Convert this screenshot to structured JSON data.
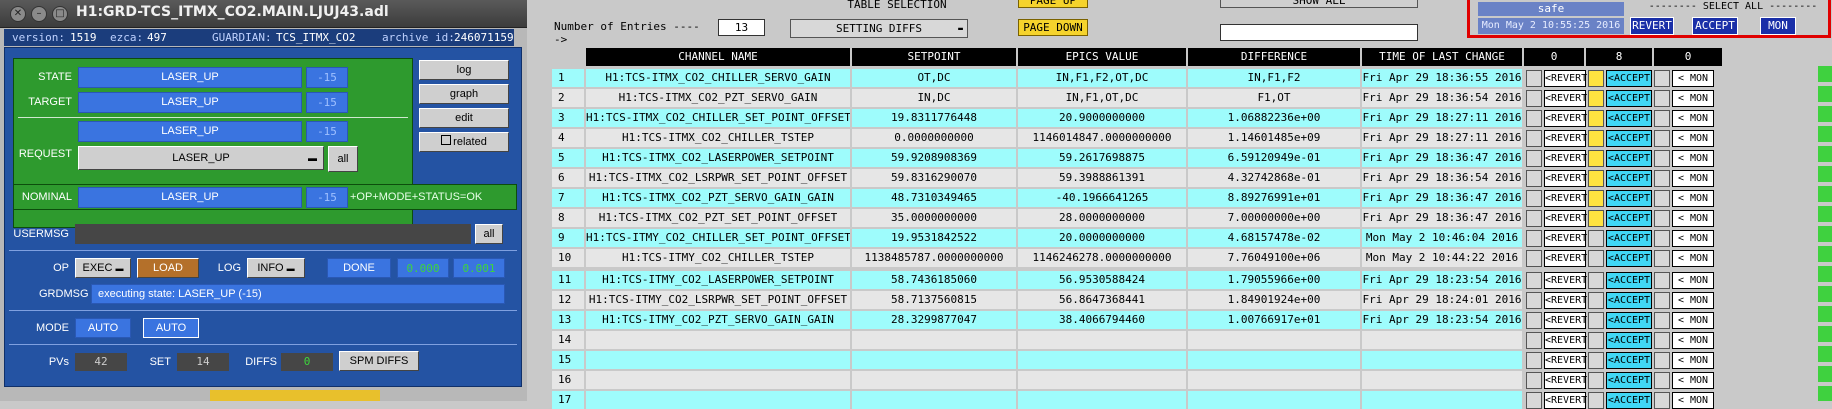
{
  "guardian": {
    "window_title": "H1:GRD-TCS_ITMX_CO2.MAIN.LJUJ43.adl",
    "info": {
      "version_label": "version:",
      "version": "1519",
      "ezca_label": "ezca:",
      "ezca": "497",
      "guardian_label": "GUARDIAN:",
      "guardian_name": "TCS_ITMX_CO2",
      "archive_label": "archive id:",
      "archive_id": "246071159"
    },
    "state": {
      "label": "STATE",
      "value": "LASER_UP",
      "index": "-15"
    },
    "target": {
      "label": "TARGET",
      "value": "LASER_UP",
      "index": "-15"
    },
    "request": {
      "label": "REQUEST",
      "value": "LASER_UP",
      "index": "-15",
      "select_value": "LASER_UP",
      "all_label": "all"
    },
    "nominal": {
      "label": "NOMINAL",
      "value": "LASER_UP",
      "index": "-15",
      "status": "+OP+MODE+STATUS=OK"
    },
    "side_buttons": [
      "log",
      "graph",
      "edit",
      "related"
    ],
    "usermsg": {
      "label": "USERMSG",
      "value": "",
      "all_label": "all"
    },
    "op": {
      "label": "OP",
      "value": "EXEC",
      "load_label": "LOAD",
      "log_label": "LOG",
      "log_value": "INFO",
      "done_label": "DONE",
      "val1": "0.000",
      "val2": "0.001"
    },
    "grdmsg": {
      "label": "GRDMSG",
      "value": "executing state: LASER_UP (-15)"
    },
    "mode": {
      "label": "MODE",
      "value1": "AUTO",
      "value2": "AUTO"
    },
    "pvs": {
      "label": "PVs",
      "value": "42",
      "set_label": "SET",
      "set_value": "14",
      "diffs_label": "DIFFS",
      "diffs_value": "0",
      "spm_button": "SPM DIFFS"
    }
  },
  "table_panel": {
    "table_selection_label": "TABLE SELECTION",
    "page_up": "PAGE UP",
    "page_down": "PAGE DOWN",
    "show_all": "SHOW ALL",
    "entries_label": "Number of Entries ----->",
    "entries_value": "13",
    "setting_diffs": "SETTING DIFFS",
    "search_value": "",
    "select_all_label": "-------- SELECT ALL --------",
    "safe_label": "safe",
    "timestamp": "Mon May  2 10:55:25 2016",
    "revert_all": "REVERT",
    "accept_all": "ACCEPT",
    "mon_all": "MON",
    "headers": [
      "CHANNEL NAME",
      "SETPOINT",
      "EPICS VALUE",
      "DIFFERENCE",
      "TIME OF LAST CHANGE",
      "0",
      "8",
      "0"
    ],
    "revert_label": "<REVERT",
    "accept_label": "<ACCEPT",
    "mon_label": "< MON",
    "rows": [
      {
        "n": "1",
        "channel": "H1:TCS-ITMX_CO2_CHILLER_SERVO_GAIN",
        "setpoint": "OT,DC",
        "epics": "IN,F1,F2,OT,DC",
        "diff": "IN,F1,F2",
        "time": "Fri Apr 29 18:36:55 2016"
      },
      {
        "n": "2",
        "channel": "H1:TCS-ITMX_CO2_PZT_SERVO_GAIN",
        "setpoint": "IN,DC",
        "epics": "IN,F1,OT,DC",
        "diff": "F1,OT",
        "time": "Fri Apr 29 18:36:54 2016"
      },
      {
        "n": "3",
        "channel": "H1:TCS-ITMX_CO2_CHILLER_SET_POINT_OFFSET",
        "setpoint": "19.8311776448",
        "epics": "20.9000000000",
        "diff": "1.06882236e+00",
        "time": "Fri Apr 29 18:27:11 2016"
      },
      {
        "n": "4",
        "channel": "H1:TCS-ITMX_CO2_CHILLER_TSTEP",
        "setpoint": "0.0000000000",
        "epics": "1146014847.0000000000",
        "diff": "1.14601485e+09",
        "time": "Fri Apr 29 18:27:11 2016"
      },
      {
        "n": "5",
        "channel": "H1:TCS-ITMX_CO2_LASERPOWER_SETPOINT",
        "setpoint": "59.9208908369",
        "epics": "59.2617698875",
        "diff": "6.59120949e-01",
        "time": "Fri Apr 29 18:36:47 2016"
      },
      {
        "n": "6",
        "channel": "H1:TCS-ITMX_CO2_LSRPWR_SET_POINT_OFFSET",
        "setpoint": "59.8316290070",
        "epics": "59.3988861391",
        "diff": "4.32742868e-01",
        "time": "Fri Apr 29 18:36:54 2016"
      },
      {
        "n": "7",
        "channel": "H1:TCS-ITMX_CO2_PZT_SERVO_GAIN_GAIN",
        "setpoint": "48.7310349465",
        "epics": "-40.1966641265",
        "diff": "8.89276991e+01",
        "time": "Fri Apr 29 18:36:47 2016"
      },
      {
        "n": "8",
        "channel": "H1:TCS-ITMX_CO2_PZT_SET_POINT_OFFSET",
        "setpoint": "35.0000000000",
        "epics": "28.0000000000",
        "diff": "7.00000000e+00",
        "time": "Fri Apr 29 18:36:47 2016"
      },
      {
        "n": "9",
        "channel": "H1:TCS-ITMY_CO2_CHILLER_SET_POINT_OFFSET",
        "setpoint": "19.9531842522",
        "epics": "20.0000000000",
        "diff": "4.68157478e-02",
        "time": "Mon May  2 10:46:04 2016"
      },
      {
        "n": "10",
        "channel": "H1:TCS-ITMY_CO2_CHILLER_TSTEP",
        "setpoint": "1138485787.0000000000",
        "epics": "1146246278.0000000000",
        "diff": "7.76049100e+06",
        "time": "Mon May  2 10:44:22 2016"
      },
      {
        "n": "11",
        "channel": "H1:TCS-ITMY_CO2_LASERPOWER_SETPOINT",
        "setpoint": "58.7436185060",
        "epics": "56.9530588424",
        "diff": "1.79055966e+00",
        "time": "Fri Apr 29 18:23:54 2016"
      },
      {
        "n": "12",
        "channel": "H1:TCS-ITMY_CO2_LSRPWR_SET_POINT_OFFSET",
        "setpoint": "58.7137560815",
        "epics": "56.8647368441",
        "diff": "1.84901924e+00",
        "time": "Fri Apr 29 18:24:01 2016"
      },
      {
        "n": "13",
        "channel": "H1:TCS-ITMY_CO2_PZT_SERVO_GAIN_GAIN",
        "setpoint": "28.3299877047",
        "epics": "38.4066794460",
        "diff": "1.00766917e+01",
        "time": "Fri Apr 29 18:23:54 2016"
      },
      {
        "n": "14",
        "channel": "",
        "setpoint": "",
        "epics": "",
        "diff": "",
        "time": ""
      },
      {
        "n": "15",
        "channel": "",
        "setpoint": "",
        "epics": "",
        "diff": "",
        "time": ""
      },
      {
        "n": "16",
        "channel": "",
        "setpoint": "",
        "epics": "",
        "diff": "",
        "time": ""
      },
      {
        "n": "17",
        "channel": "",
        "setpoint": "",
        "epics": "",
        "diff": "",
        "time": ""
      }
    ],
    "accept_checked_rows": [
      1,
      2,
      3,
      4,
      5,
      6,
      7,
      8
    ]
  },
  "colors": {
    "row_cyan": "#9efcfc",
    "row_light": "#e6e6e6",
    "guardian_blue": "#2453a3",
    "state_green": "#2e9a2e",
    "select_all_border": "#e00000",
    "checked_yellow": "#ffe340"
  }
}
